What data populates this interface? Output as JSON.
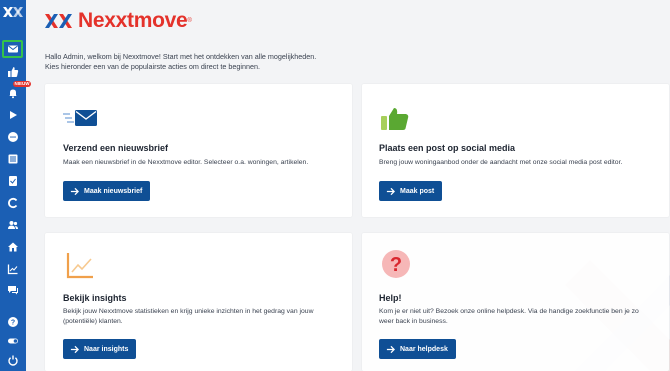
{
  "brand": {
    "name": "Nexxtmove",
    "registered": "®"
  },
  "sidebar": {
    "badge": "NIEUW",
    "items": [
      {
        "icon": "envelope-icon"
      },
      {
        "icon": "thumbs-up-icon"
      },
      {
        "icon": "bell-icon"
      },
      {
        "icon": "play-icon"
      },
      {
        "icon": "chat-icon"
      },
      {
        "icon": "list-icon"
      },
      {
        "icon": "document-check-icon"
      },
      {
        "icon": "refresh-icon"
      },
      {
        "icon": "users-icon"
      },
      {
        "icon": "home-icon"
      },
      {
        "icon": "chart-icon"
      },
      {
        "icon": "messages-icon"
      },
      {
        "icon": "help-icon"
      },
      {
        "icon": "toggle-icon"
      },
      {
        "icon": "power-icon"
      }
    ]
  },
  "intro": {
    "line1": "Hallo Admin, welkom bij Nexxtmove! Start met het ontdekken van alle mogelijkheden.",
    "line2": "Kies hieronder een van de populairste acties om direct te beginnen."
  },
  "cards": {
    "newsletter": {
      "title": "Verzend een nieuwsbrief",
      "desc": "Maak een nieuwsbrief in de Nexxtmove editor. Selecteer o.a. woningen, artikelen.",
      "button": "Maak nieuwsbrief"
    },
    "social": {
      "title": "Plaats een post op social media",
      "desc": "Breng jouw woningaanbod onder de aandacht met onze social media post editor.",
      "button": "Maak post"
    },
    "insights": {
      "title": "Bekijk insights",
      "desc1": "Bekijk jouw Nexxtmove statistieken en krijg unieke inzichten in het gedrag van jouw",
      "desc2": "(potentiële) klanten.",
      "button": "Naar insights"
    },
    "help": {
      "title": "Help!",
      "desc1": "Kom je er niet uit? Bezoek onze online helpdesk. Via de handige zoekfunctie ben je zo",
      "desc2": "weer back in business.",
      "button": "Naar helpdesk"
    }
  },
  "colors": {
    "sidebar": "#1b5fb4",
    "brand": "#e4322b",
    "button": "#0f4f95",
    "active": "#34c24a"
  }
}
